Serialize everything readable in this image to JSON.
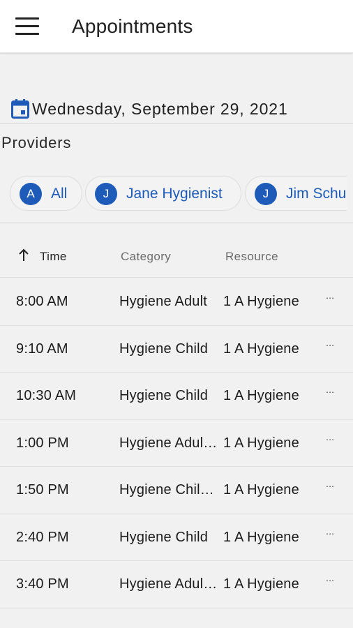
{
  "app_bar": {
    "title": "Appointments",
    "menu_icon": "hamburger-menu-icon"
  },
  "date_selector": {
    "icon": "calendar-icon",
    "date": "Wednesday, September 29, 2021"
  },
  "providers": {
    "title": "Providers",
    "chips": [
      {
        "initial": "A",
        "label": "All"
      },
      {
        "initial": "J",
        "label": "Jane Hygienist"
      },
      {
        "initial": "J",
        "label": "Jim Schu"
      }
    ]
  },
  "table": {
    "sort_icon": "arrow-up-icon",
    "headers": {
      "time": "Time",
      "category": "Category",
      "resource": "Resource"
    },
    "rows": [
      {
        "time": "8:00 AM",
        "category": "Hygiene Adult",
        "resource": "1 A Hygiene",
        "more": "..."
      },
      {
        "time": "9:10 AM",
        "category": "Hygiene Child",
        "resource": "1 A Hygiene",
        "more": "..."
      },
      {
        "time": "10:30 AM",
        "category": "Hygiene Child",
        "resource": "1 A Hygiene",
        "more": "..."
      },
      {
        "time": "1:00 PM",
        "category": "Hygiene Adul…",
        "resource": "1 A Hygiene",
        "more": "..."
      },
      {
        "time": "1:50 PM",
        "category": "Hygiene Chil…",
        "resource": "1 A Hygiene",
        "more": "..."
      },
      {
        "time": "2:40 PM",
        "category": "Hygiene Child",
        "resource": "1 A Hygiene",
        "more": "..."
      },
      {
        "time": "3:40 PM",
        "category": "Hygiene Adul…",
        "resource": "1 A Hygiene",
        "more": "..."
      }
    ]
  },
  "colors": {
    "accent": "#1e5bb8",
    "background": "#f1f1f1",
    "app_bar": "#ffffff"
  }
}
